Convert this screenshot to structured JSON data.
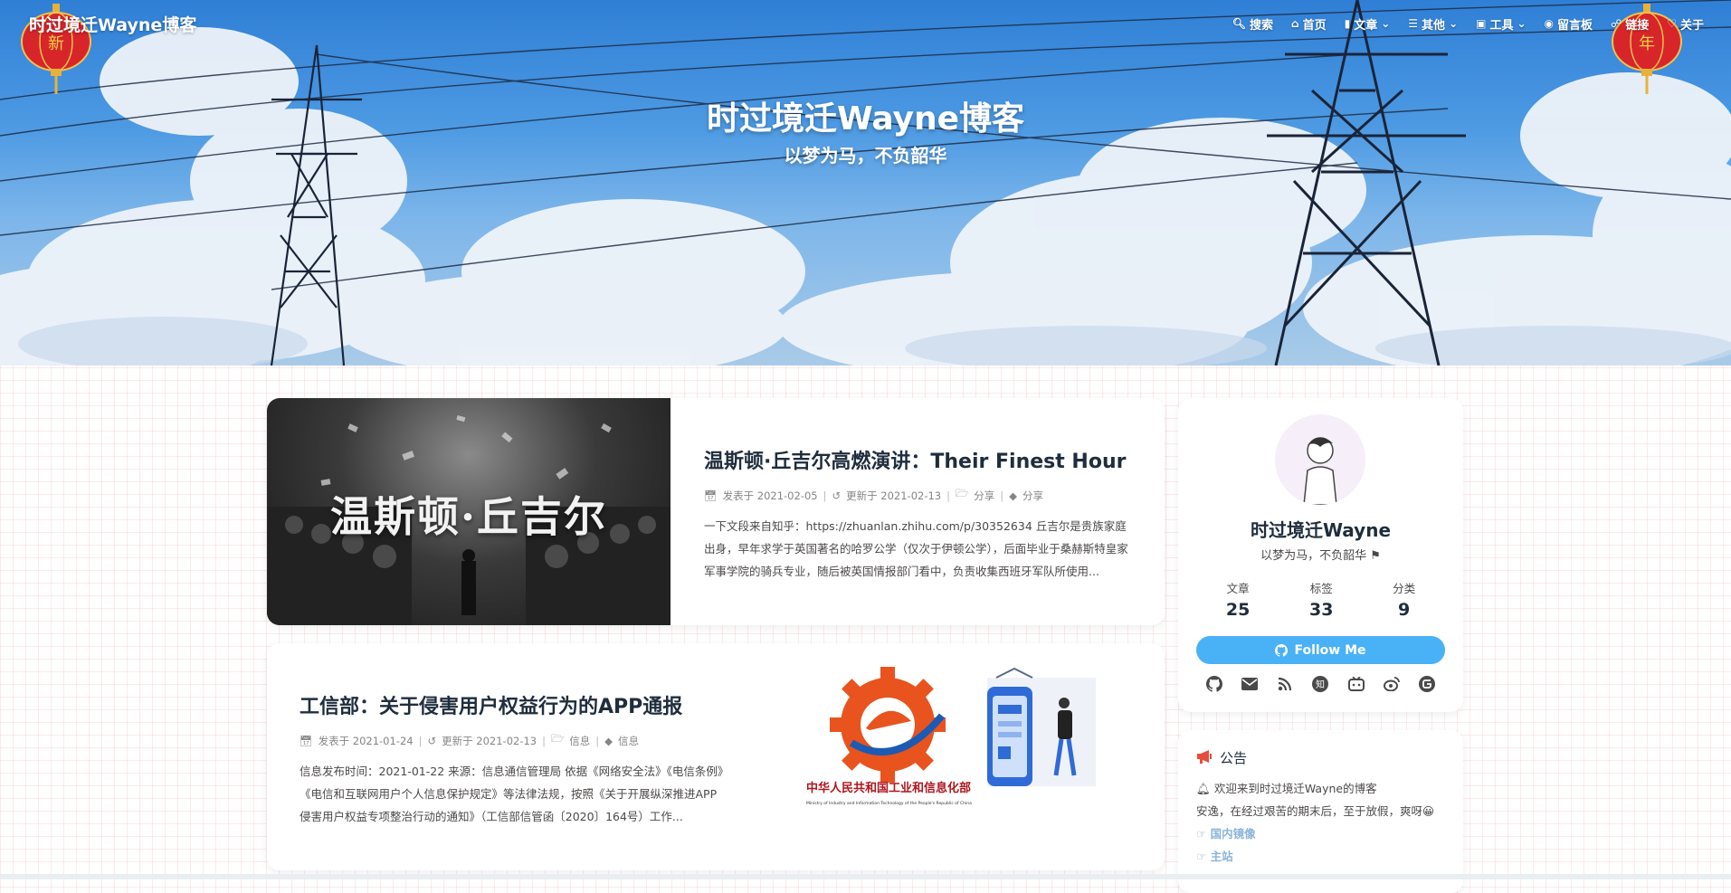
{
  "nav": {
    "brand": "时过境迁Wayne博客",
    "items": [
      {
        "icon": "search-icon",
        "label": "搜索"
      },
      {
        "icon": "home-icon",
        "label": "首页"
      },
      {
        "icon": "bookmark-icon",
        "label": "文章"
      },
      {
        "icon": "list-icon",
        "label": "其他"
      },
      {
        "icon": "gift-icon",
        "label": "工具"
      },
      {
        "icon": "comment-icon",
        "label": "留言板"
      },
      {
        "icon": "link-icon",
        "label": "链接"
      },
      {
        "icon": "heart-icon",
        "label": "关于"
      }
    ],
    "lanterns": [
      "新",
      "年"
    ]
  },
  "hero": {
    "title": "时过境迁Wayne博客",
    "subtitle": "以梦为马，不负韶华"
  },
  "posts": [
    {
      "cover_text": "温斯顿·丘吉尔",
      "title": "温斯顿·丘吉尔高燃演讲：Their Finest Hour",
      "published": "发表于 2021-02-05",
      "updated": "更新于 2021-02-13",
      "category": "分享",
      "tag": "分享",
      "excerpt": "一下文段来自知乎：https://zhuanlan.zhihu.com/p/30352634 丘吉尔是贵族家庭出身，早年求学于英国著名的哈罗公学（仅次于伊顿公学），后面毕业于桑赫斯特皇家军事学院的骑兵专业，随后被英国情报部门看中，负责收集西班牙军队所使用..."
    },
    {
      "title": "工信部：关于侵害用户权益行为的APP通报",
      "published": "发表于 2021-01-24",
      "updated": "更新于 2021-02-13",
      "category": "信息",
      "tag": "信息",
      "excerpt": "信息发布时间：2021-01-22 来源：信息通信管理局 依据《网络安全法》《电信条例》《电信和互联网用户个人信息保护规定》等法律法规，按照《关于开展纵深推进APP侵害用户权益专项整治行动的通知》（工信部信管函〔2020〕164号）工作...",
      "cover_caption": "中华人民共和国工业和信息化部",
      "cover_caption_en": "Ministry of Industry and Information Technology of the People's Republic of China"
    }
  ],
  "profile": {
    "name": "时过境迁Wayne",
    "desc": "以梦为马，不负韶华",
    "stats": [
      {
        "label": "文章",
        "value": "25"
      },
      {
        "label": "标签",
        "value": "33"
      },
      {
        "label": "分类",
        "value": "9"
      }
    ],
    "follow_label": "Follow Me",
    "socials": [
      "github-icon",
      "email-icon",
      "rss-icon",
      "zhihu-icon",
      "bilibili-icon",
      "weibo-icon",
      "gitee-icon"
    ]
  },
  "notice": {
    "heading": "公告",
    "line1": "欢迎来到时过境迁Wayne的博客",
    "line2": "安逸，在经过艰苦的期末后，至于放假，爽呀😀",
    "links": [
      "国内镜像",
      "主站"
    ]
  },
  "colors": {
    "accent": "#49b1f5",
    "notice_icon": "#e74c3c",
    "lantern": "#d8252a"
  }
}
